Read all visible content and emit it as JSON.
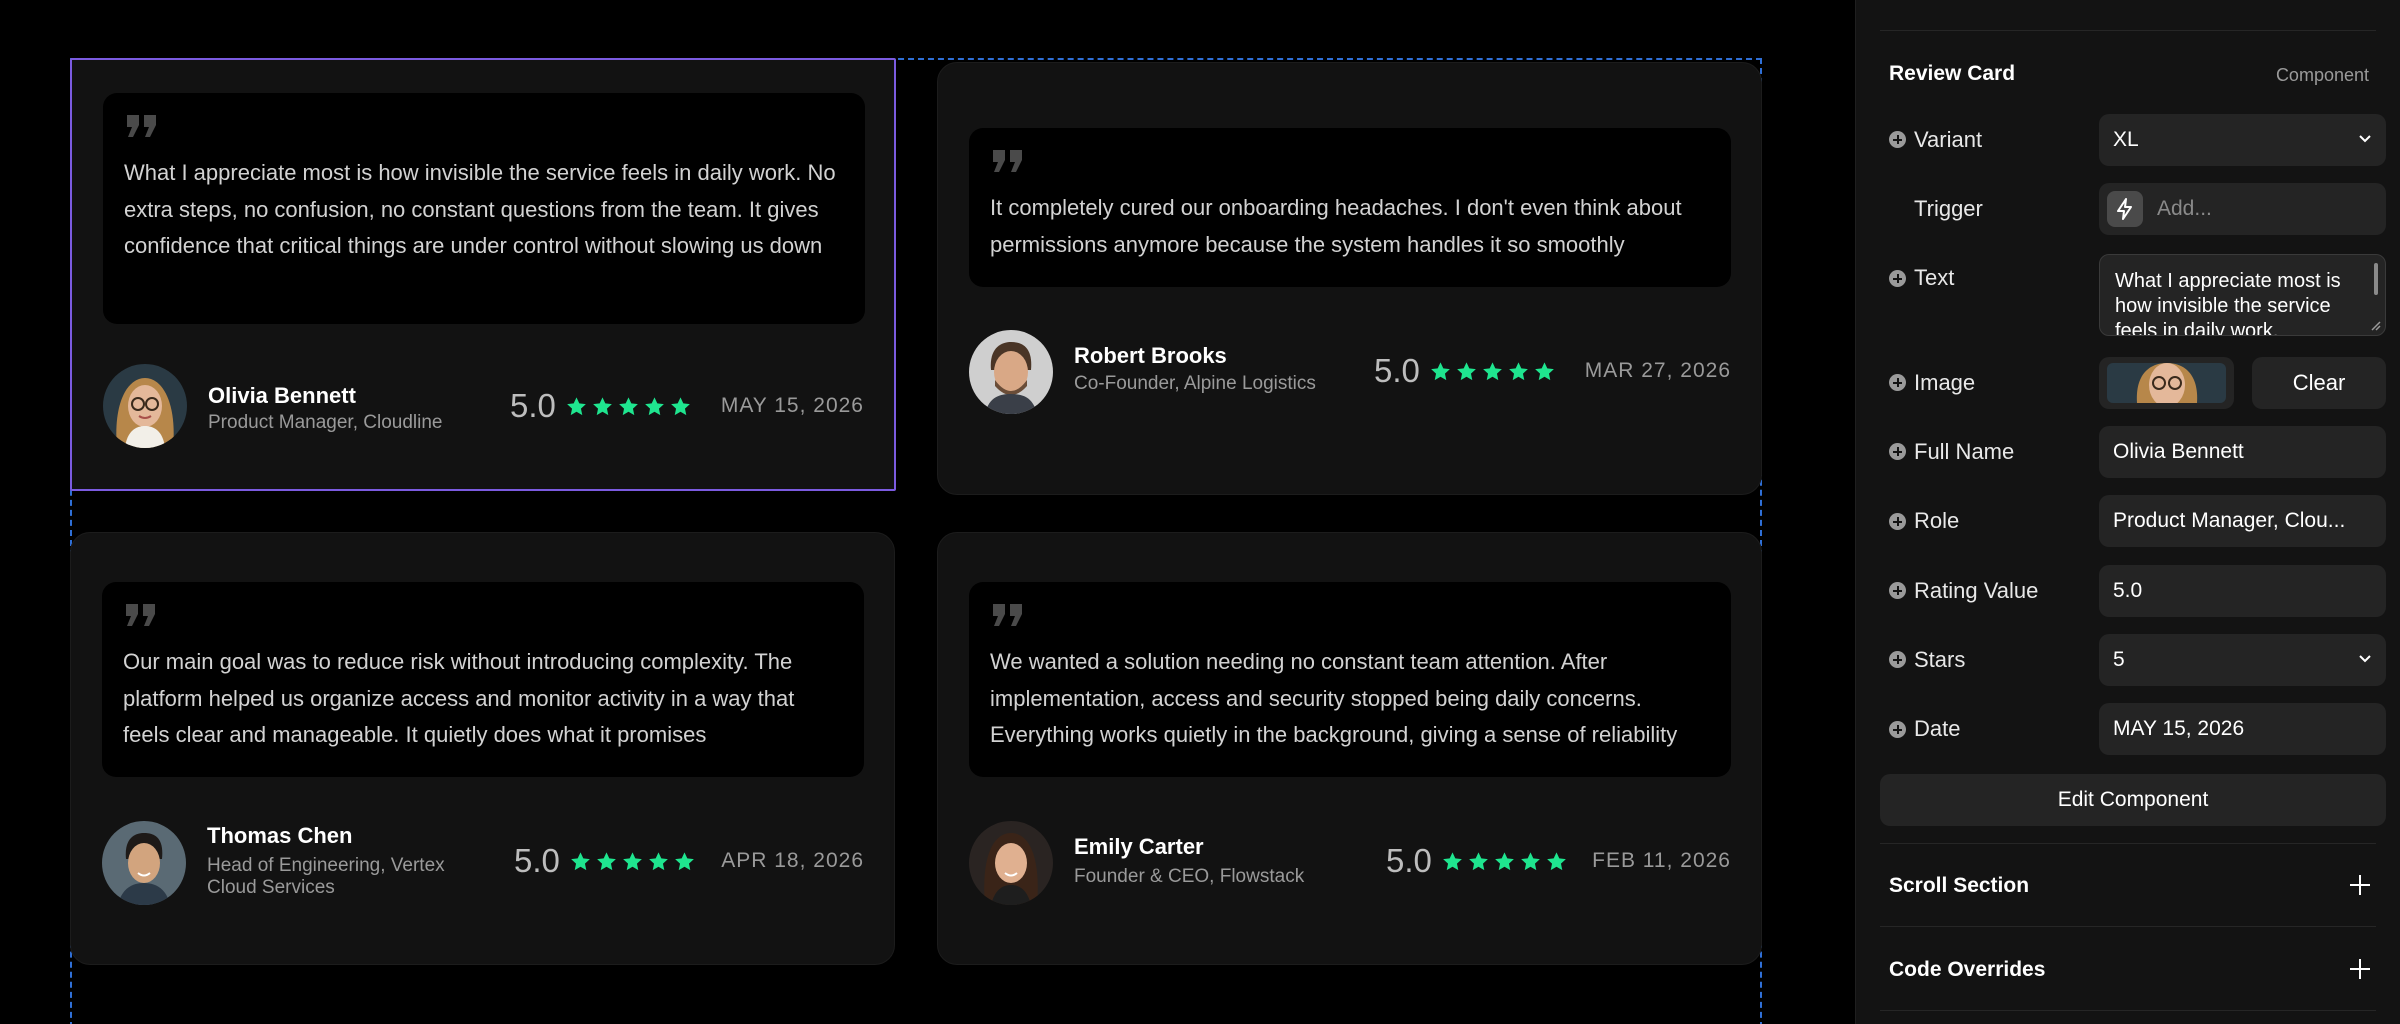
{
  "canvas": {
    "cards": [
      {
        "quote": "What I appreciate most is how invisible the service feels in daily work. No extra steps, no confusion, no constant questions from the team. It gives confidence that critical things are under control without slowing us down",
        "name": "Olivia Bennett",
        "role": "Product Manager, Cloudline",
        "rating": "5.0",
        "stars": 5,
        "date": "MAY 15, 2026",
        "avatar": "woman-with-glasses-avatar"
      },
      {
        "quote": "It completely cured our onboarding headaches. I don't even think about permissions anymore because the system handles it so smoothly",
        "name": "Robert Brooks",
        "role": "Co-Founder, Alpine Logistics",
        "rating": "5.0",
        "stars": 5,
        "date": "MAR 27, 2026",
        "avatar": "man-with-beard-avatar"
      },
      {
        "quote": "Our main goal was to reduce risk without introducing complexity. The platform helped us organize access and monitor activity in a way that feels clear and manageable. It quietly does what it promises",
        "name": "Thomas Chen",
        "role": "Head of Engineering, Vertex Cloud Services",
        "rating": "5.0",
        "stars": 5,
        "date": "APR 18, 2026",
        "avatar": "man-avatar"
      },
      {
        "quote": "We wanted a solution needing no constant team attention. After implementation, access and security stopped being daily concerns. Everything works quietly in the background, giving a sense of reliability",
        "name": "Emily Carter",
        "role": "Founder & CEO, Flowstack",
        "rating": "5.0",
        "stars": 5,
        "date": "FEB 11, 2026",
        "avatar": "woman-avatar"
      }
    ],
    "colors": {
      "star": "#1fe58f",
      "selection": "#7b5be0",
      "frame": "#2f6fd6"
    }
  },
  "panel": {
    "section_title": "Review Card",
    "section_meta": "Component",
    "props": {
      "variant": {
        "label": "Variant",
        "value": "XL"
      },
      "trigger": {
        "label": "Trigger",
        "placeholder": "Add..."
      },
      "text": {
        "label": "Text",
        "value": "What I appreciate most is how invisible the service feels in daily work."
      },
      "image": {
        "label": "Image",
        "clear": "Clear"
      },
      "full_name": {
        "label": "Full Name",
        "value": "Olivia Bennett"
      },
      "role": {
        "label": "Role",
        "value": "Product Manager, Clou..."
      },
      "rating_value": {
        "label": "Rating Value",
        "value": "5.0"
      },
      "stars": {
        "label": "Stars",
        "value": "5"
      },
      "date": {
        "label": "Date",
        "value": "MAY 15, 2026"
      }
    },
    "edit_button": "Edit Component",
    "scroll_section": "Scroll Section",
    "code_overrides": "Code Overrides"
  }
}
